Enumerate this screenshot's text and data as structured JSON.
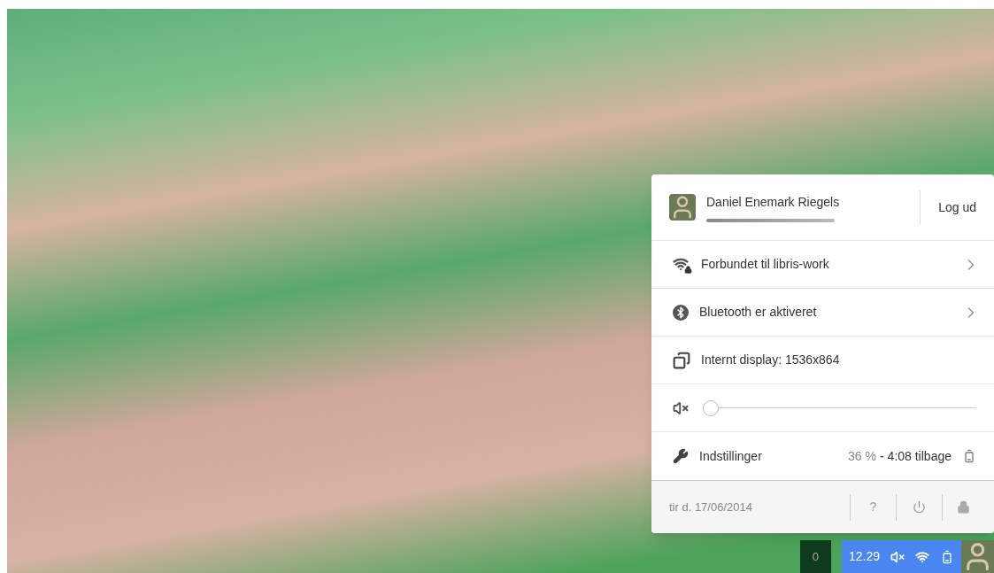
{
  "user": {
    "name": "Daniel Enemark Riegels",
    "logout": "Log ud"
  },
  "rows": [
    {
      "kind": "wifi",
      "label": "Forbundet til libris-work",
      "expandable": true
    },
    {
      "kind": "bluetooth",
      "label": "Bluetooth er aktiveret",
      "expandable": true
    },
    {
      "kind": "display",
      "label": "Internt display: 1536x864",
      "expandable": false
    }
  ],
  "volume": {
    "muted": true,
    "level": 0.0
  },
  "settings": {
    "label": "Indstillinger",
    "battery_percent": "36 %",
    "separator": "-",
    "battery_time": "4:08 tilbage"
  },
  "footer": {
    "date": "tir d. 17/06/2014",
    "help": "?"
  },
  "shelf": {
    "notifications": "0",
    "time": "12.29",
    "muted": true
  }
}
